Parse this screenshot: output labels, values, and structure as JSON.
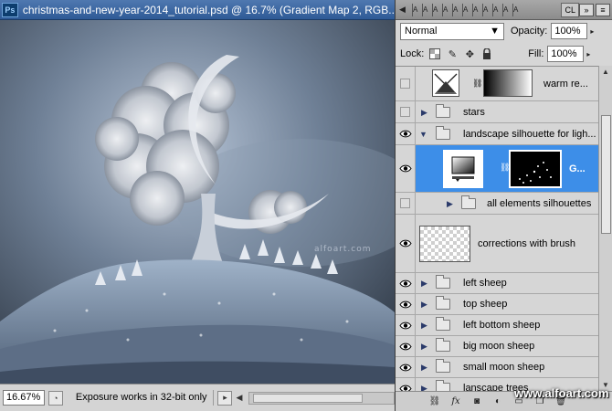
{
  "document": {
    "app_icon": "Ps",
    "title": "christmas-and-new-year-2014_tutorial.psd @ 16.7% (Gradient Map 2, RGB...",
    "watermark": "alfoart.com"
  },
  "statusbar": {
    "zoom": "16.67%",
    "info": "Exposure works in 32-bit only"
  },
  "panel": {
    "tab_letters": [
      "A",
      "A",
      "A",
      "A",
      "A",
      "A",
      "A",
      "A",
      "A",
      "A",
      "A"
    ],
    "current_tab": "CL",
    "blend_mode": "Normal",
    "opacity_label": "Opacity:",
    "opacity_value": "100%",
    "lock_label": "Lock:",
    "fill_label": "Fill:",
    "fill_value": "100%",
    "lock_icons": [
      "lock-transparent-icon",
      "lock-paint-icon",
      "lock-move-icon",
      "lock-all-icon"
    ],
    "footer_icons": [
      "link-layers-icon",
      "layer-style-fx-icon",
      "layer-mask-icon",
      "adjustment-layer-icon",
      "new-group-icon",
      "new-layer-icon",
      "delete-layer-icon"
    ],
    "footer_credit": "www.alfoart.com"
  },
  "layers": [
    {
      "name": "warm re...",
      "type": "adjustment",
      "visible": false,
      "expanded": null,
      "indent": 0
    },
    {
      "name": "stars",
      "type": "group",
      "visible": false,
      "expanded": false,
      "indent": 0
    },
    {
      "name": "landscape silhouette for ligh...",
      "type": "group",
      "visible": true,
      "expanded": true,
      "indent": 0
    },
    {
      "name": "G...",
      "type": "adjustment-mask",
      "visible": true,
      "expanded": null,
      "indent": 1,
      "selected": true
    },
    {
      "name": "all elements silhouettes",
      "type": "group",
      "visible": false,
      "expanded": false,
      "indent": 1
    },
    {
      "name": "corrections with brush",
      "type": "pixel",
      "visible": true,
      "expanded": null,
      "indent": 0
    },
    {
      "name": "left sheep",
      "type": "group",
      "visible": true,
      "expanded": false,
      "indent": 0
    },
    {
      "name": "top sheep",
      "type": "group",
      "visible": true,
      "expanded": false,
      "indent": 0
    },
    {
      "name": "left bottom sheep",
      "type": "group",
      "visible": true,
      "expanded": false,
      "indent": 0
    },
    {
      "name": "big moon sheep",
      "type": "group",
      "visible": true,
      "expanded": false,
      "indent": 0
    },
    {
      "name": "small moon sheep",
      "type": "group",
      "visible": true,
      "expanded": false,
      "indent": 0
    },
    {
      "name": "lanscape trees",
      "type": "group",
      "visible": true,
      "expanded": false,
      "indent": 0
    }
  ],
  "colors": {
    "selection": "#3d8ee8",
    "panel_bg": "#d6d6d6",
    "titlebar": "#2e5a96"
  }
}
